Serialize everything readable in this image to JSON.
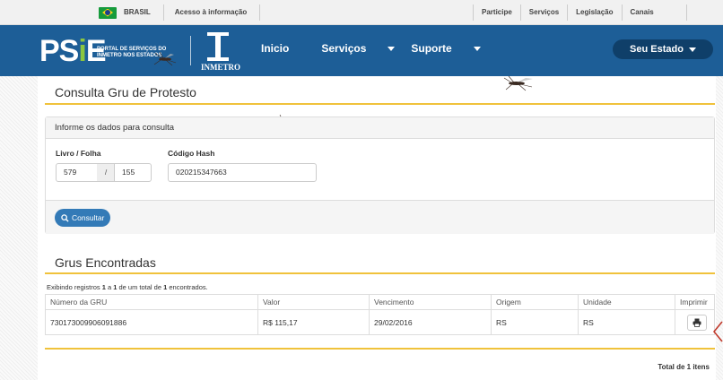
{
  "govbar": {
    "brasil": "BRASIL",
    "access": "Acesso à informação",
    "links": [
      "Participe",
      "Serviços",
      "Legislação",
      "Canais"
    ]
  },
  "header": {
    "logo": "PSiE",
    "logo_sub": "PORTAL DE SERVIÇOS DO INMETRO NOS ESTADOS",
    "inmetro": "INMETRO",
    "nav": [
      "Inicio",
      "Serviços",
      "Suporte"
    ],
    "estado": "Seu Estado"
  },
  "page": {
    "title": "Consulta Gru de Protesto"
  },
  "form": {
    "panel_title": "Informe os dados para consulta",
    "livro_folha_label": "Livro / Folha",
    "livro_value": "579",
    "separator": "/",
    "folha_value": "155",
    "hash_label": "Código Hash",
    "hash_value": "020215347663",
    "consultar_label": "Consultar"
  },
  "results": {
    "title": "Grus Encontradas",
    "info_prefix": "Exibindo registros ",
    "info_from": "1",
    "info_mid1": " a ",
    "info_to": "1",
    "info_mid2": " de um total de ",
    "info_total": "1",
    "info_suffix": " encontrados.",
    "columns": [
      "Número da GRU",
      "Valor",
      "Vencimento",
      "Origem",
      "Unidade",
      "Imprimir"
    ],
    "rows": [
      [
        "730173009906091886",
        "R$ 115,17",
        "29/02/2016",
        "RS",
        "RS"
      ]
    ],
    "total_label": "Total de 1 itens"
  },
  "colors": {
    "header_bg": "#1d5e97",
    "accent_rule": "#f0c23b",
    "button_blue": "#337ab7",
    "logo_green": "#8cc63f"
  }
}
